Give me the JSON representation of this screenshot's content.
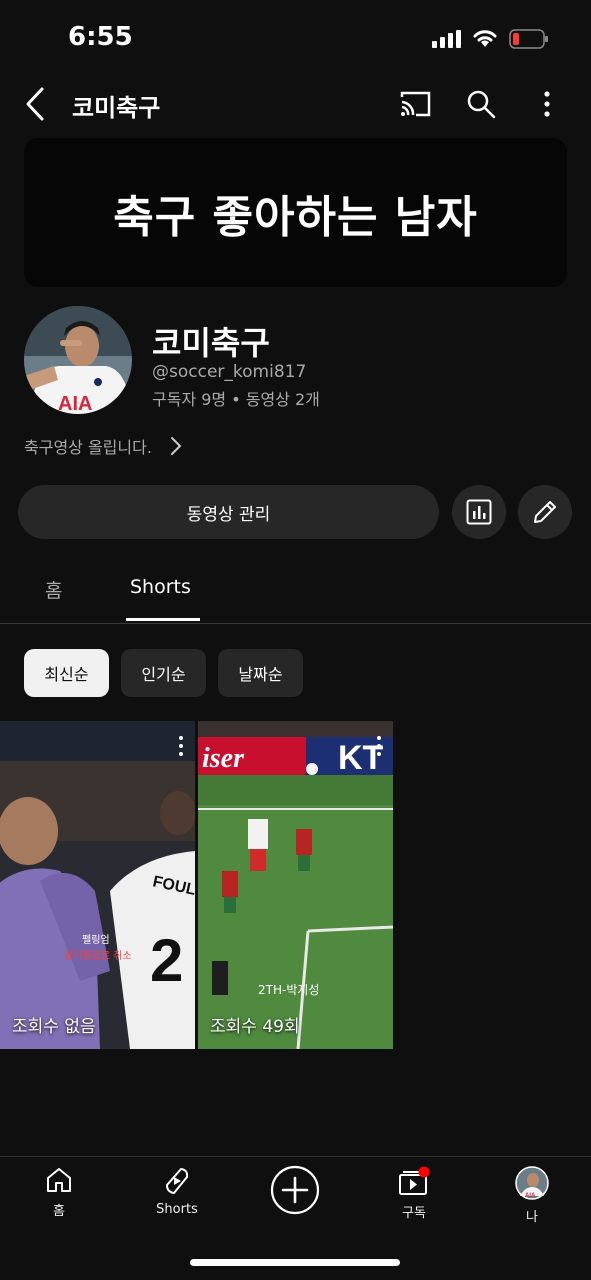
{
  "status_bar": {
    "time": "6:55"
  },
  "header": {
    "title": "코미축구"
  },
  "banner": {
    "text": "축구 좋아하는 남자"
  },
  "channel": {
    "name": "코미축구",
    "handle": "@soccer_komi817",
    "stats": "구독자 9명 • 동영상 2개",
    "description": "축구영상 올립니다."
  },
  "actions": {
    "manage_videos": "동영상 관리"
  },
  "tabs": [
    {
      "label": "홈"
    },
    {
      "label": "Shorts"
    }
  ],
  "filters": [
    {
      "label": "최신순",
      "selected": true
    },
    {
      "label": "인기순"
    },
    {
      "label": "날짜순"
    }
  ],
  "shorts": [
    {
      "views": "조회수 없음",
      "caption_top": "펠링엄",
      "caption_bottom": "경기종료로 취소"
    },
    {
      "views": "조회수 49회",
      "caption": "2TH-박지성",
      "billboard_left": "iser",
      "billboard_right": "KT"
    }
  ],
  "bottom_nav": [
    {
      "label": "홈"
    },
    {
      "label": "Shorts"
    },
    {
      "label": ""
    },
    {
      "label": "구독"
    },
    {
      "label": "나"
    }
  ],
  "colors": {
    "background": "#0f0f0f",
    "chip_selected": "#f1f1f1",
    "surface": "#272727",
    "notification": "#ff0000"
  }
}
